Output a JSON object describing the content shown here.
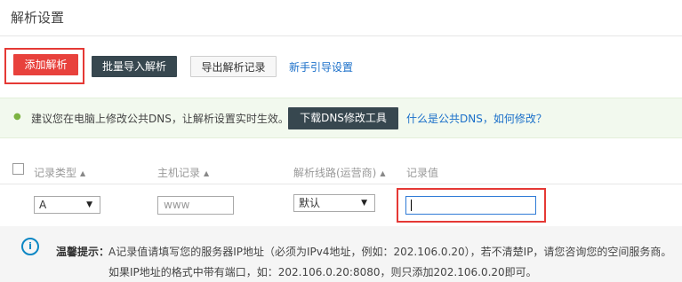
{
  "page": {
    "title": "解析设置"
  },
  "toolbar": {
    "add_label": "添加解析",
    "bulk_import_label": "批量导入解析",
    "export_label": "导出解析记录",
    "guide_link": "新手引导设置"
  },
  "notice": {
    "text": "建议您在电脑上修改公共DNS，让解析设置实时生效。",
    "download_label": "下载DNS修改工具",
    "help_link": "什么是公共DNS，如何修改？"
  },
  "table": {
    "headers": {
      "record_type": "记录类型",
      "host": "主机记录",
      "line": "解析线路(运营商)",
      "value": "记录值"
    }
  },
  "row": {
    "record_type": "A",
    "host_placeholder": "www",
    "line": "默认",
    "value": ""
  },
  "tip": {
    "label": "温馨提示：",
    "line1": "A记录值请填写您的服务器IP地址（必须为IPv4地址，例如：202.106.0.20），若不清楚IP，请您咨询您的空间服务商。",
    "line2": "如果IP地址的格式中带有端口，如：202.106.0.20:8080，则只添加202.106.0.20即可。"
  },
  "icons": {
    "sort": "sort-up-icon",
    "dropdown": "caret-down-icon",
    "info": "info-icon"
  },
  "colors": {
    "primary_red": "#e8413c",
    "dark_button": "#37474f",
    "link": "#1a6fc9",
    "highlight": "#e53935",
    "notice_bg": "#f2f9ee",
    "info_blue": "#0d87c4"
  }
}
